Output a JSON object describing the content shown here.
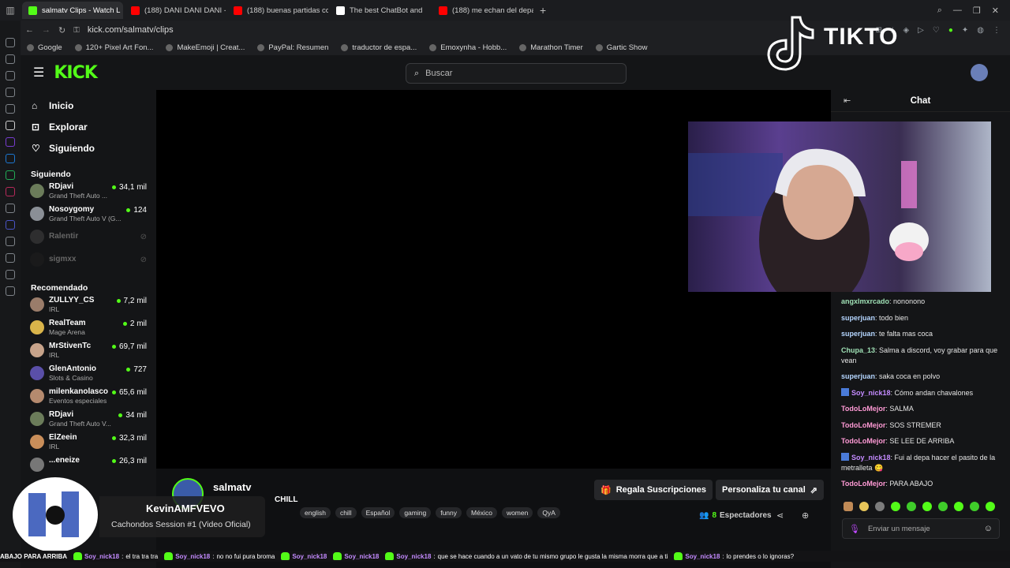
{
  "browser": {
    "tabs": [
      {
        "label": "salmatv Clips - Watch L",
        "favicon_color": "#53fc18",
        "active": true
      },
      {
        "label": "(188) DANI DANI DANI - Y",
        "favicon_color": "#ff0000"
      },
      {
        "label": "(188) buenas partidas co",
        "favicon_color": "#ff0000"
      },
      {
        "label": "The best ChatBot and",
        "favicon_color": "#ffffff"
      },
      {
        "label": "(188) me echan del depar",
        "favicon_color": "#ff0000"
      }
    ],
    "url": "kick.com/salmatv/clips",
    "bookmarks": [
      "Google",
      "120+ Pixel Art Fon...",
      "MakeEmoji | Creat...",
      "PayPal: Resumen",
      "traductor de espa...",
      "Emoxynha - Hobb...",
      "Marathon Timer",
      "Gartic Show"
    ]
  },
  "header": {
    "logo": "KICK",
    "search_placeholder": "Buscar"
  },
  "sidebar": {
    "nav": [
      {
        "label": "Inicio",
        "icon": "home-icon"
      },
      {
        "label": "Explorar",
        "icon": "compass-icon"
      },
      {
        "label": "Siguiendo",
        "icon": "heart-icon"
      }
    ],
    "following_title": "Siguiendo",
    "following": [
      {
        "name": "RDjavi",
        "game": "Grand Theft Auto ...",
        "viewers": "34,1 mil",
        "live": true,
        "color": "#6b7c5a"
      },
      {
        "name": "Nosoygomy",
        "game": "Grand Theft Auto V (G...",
        "viewers": "124",
        "live": true,
        "color": "#8a8f96"
      },
      {
        "name": "Ralentir",
        "game": "",
        "viewers": "",
        "live": false,
        "color": "#555"
      },
      {
        "name": "sigmxx",
        "game": "",
        "viewers": "",
        "live": false,
        "color": "#222"
      }
    ],
    "recommended_title": "Recomendado",
    "recommended": [
      {
        "name": "ZULLYY_CS",
        "game": "IRL",
        "viewers": "7,2 mil",
        "color": "#9a7c6a"
      },
      {
        "name": "RealTeam",
        "game": "Mage Arena",
        "viewers": "2 mil",
        "color": "#d9b44a"
      },
      {
        "name": "MrStivenTc",
        "game": "IRL",
        "viewers": "69,7 mil",
        "color": "#c7a38a"
      },
      {
        "name": "GlenAntonio",
        "game": "Slots & Casino",
        "viewers": "727",
        "color": "#5a4fa8"
      },
      {
        "name": "milenkanolasco",
        "game": "Eventos especiales",
        "viewers": "65,6 mil",
        "color": "#b58a6e"
      },
      {
        "name": "RDjavi",
        "game": "Grand Theft Auto V...",
        "viewers": "34 mil",
        "color": "#6b7c5a"
      },
      {
        "name": "ElZeein",
        "game": "IRL",
        "viewers": "32,3 mil",
        "color": "#c98e5a"
      },
      {
        "name": "...eneize",
        "game": "",
        "viewers": "26,3 mil",
        "color": "#777"
      }
    ]
  },
  "channel": {
    "name": "salmatv",
    "stream_title_fragment": "CHILL",
    "tags": [
      "english",
      "chill",
      "Español",
      "gaming",
      "funny",
      "México",
      "women",
      "QyA"
    ],
    "gift_button": "Regala Suscripciones",
    "customize_button": "Personaliza tu canal",
    "viewers_count": "8",
    "viewers_label": "Espectadores"
  },
  "chat": {
    "title": "Chat",
    "input_placeholder": "Enviar un mensaje",
    "messages": [
      {
        "user": "angxlmxrcado",
        "text": "nononono",
        "color": "#9fe0b5",
        "badge": false
      },
      {
        "user": "superjuan",
        "text": "todo bien",
        "color": "#b5d6ff",
        "badge": false
      },
      {
        "user": "superjuan",
        "text": "te falta mas coca",
        "color": "#b5d6ff",
        "badge": false
      },
      {
        "user": "Chupa_13",
        "text": "Salma a discord, voy grabar para que vean",
        "color": "#9fe0b5",
        "badge": false
      },
      {
        "user": "superjuan",
        "text": "saka coca en polvo",
        "color": "#b5d6ff",
        "badge": false
      },
      {
        "user": "Soy_nick18",
        "text": "Cómo andan chavalones",
        "color": "#c48bff",
        "badge": true
      },
      {
        "user": "TodoLoMejor",
        "text": "SALMA",
        "color": "#ff9ad5",
        "badge": false
      },
      {
        "user": "TodoLoMejor",
        "text": "SOS STREMER",
        "color": "#ff9ad5",
        "badge": false
      },
      {
        "user": "TodoLoMejor",
        "text": "SE LEE DE ARRIBA",
        "color": "#ff9ad5",
        "badge": false
      },
      {
        "user": "Soy_nick18",
        "text": "Fui al depa hacer el pasito de la metralleta 😋",
        "color": "#c48bff",
        "badge": true
      },
      {
        "user": "TodoLoMejor",
        "text": "PARA ABAJO",
        "color": "#ff9ad5",
        "badge": false
      }
    ]
  },
  "overlay": {
    "tiktok_text": "TIKTO",
    "music_artist": "KevinAMFVEVO",
    "music_title": "Cachondos Session #1 (Video Oficial)",
    "ticker": [
      {
        "user": "",
        "text": "ABAJO PARA ARRIBA"
      },
      {
        "user": "Soy_nick18",
        "text": "el tra tra tra"
      },
      {
        "user": "Soy_nick18",
        "text": "no no fui pura broma"
      },
      {
        "user": "Soy_nick18",
        "text": ""
      },
      {
        "user": "Soy_nick18",
        "text": ""
      },
      {
        "user": "Soy_nick18",
        "text": "que se hace cuando a un vato de tu mismo grupo le gusta la misma morra que a ti"
      },
      {
        "user": "Soy_nick18",
        "text": "lo prendes o lo ignoras?"
      }
    ]
  },
  "colors": {
    "brand": "#53fc18",
    "bg": "#0f1012",
    "panel": "#141517"
  }
}
